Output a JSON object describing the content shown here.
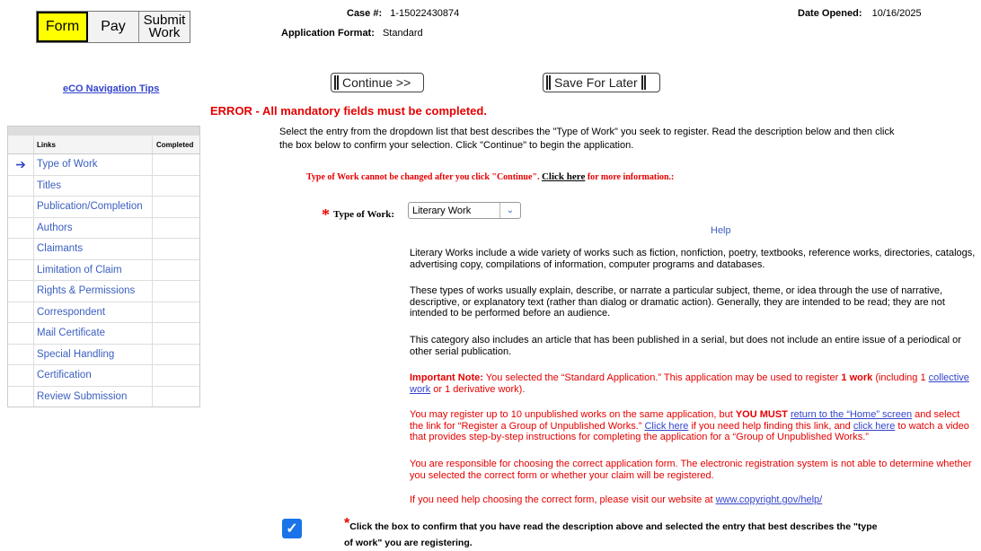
{
  "tabs": {
    "form": "Form",
    "pay": "Pay",
    "submit": "Submit Work"
  },
  "case": {
    "label": "Case #:",
    "value": "1-15022430874"
  },
  "format": {
    "label": "Application Format:",
    "value": "Standard"
  },
  "date_opened": {
    "label": "Date Opened:",
    "value": "10/16/2025"
  },
  "nav_tips": "eCO Navigation Tips",
  "buttons": {
    "continue": "Continue >>",
    "save": "Save For Later"
  },
  "error": "ERROR - All mandatory fields must be completed.",
  "instructions": "Select the entry from the dropdown list that best describes the \"Type of Work\" you seek to register. Read the description below and then click the box below to confirm your selection. Click \"Continue\" to begin the application.",
  "warning": {
    "text": "Type of Work cannot be changed after you click \"Continue\".",
    "link": "Click here",
    "after": "for more information.:"
  },
  "sidebar": {
    "header_links": "Links",
    "header_completed": "Completed",
    "items": [
      {
        "label": "Type of Work",
        "current": true
      },
      {
        "label": "Titles"
      },
      {
        "label": "Publication/Completion"
      },
      {
        "label": "Authors"
      },
      {
        "label": "Claimants"
      },
      {
        "label": "Limitation of Claim"
      },
      {
        "label": "Rights & Permissions"
      },
      {
        "label": "Correspondent"
      },
      {
        "label": "Mail Certificate"
      },
      {
        "label": "Special Handling"
      },
      {
        "label": "Certification"
      },
      {
        "label": "Review Submission"
      }
    ]
  },
  "type_of_work": {
    "label": "Type of Work:",
    "selected": "Literary Work",
    "help": "Help"
  },
  "description": {
    "p1": "Literary Works include a wide variety of works such as fiction, nonfiction, poetry, textbooks, reference works, directories, catalogs, advertising copy, compilations of information, computer programs and databases.",
    "p2": "These types of works usually explain, describe, or narrate a particular subject, theme, or idea through the use of narrative, descriptive, or explanatory text (rather than dialog or dramatic action). Generally, they are intended to be read; they are not intended to be performed before an audience.",
    "p3": "This category also includes an article that has been published in a serial, but does not include an entire issue of a periodical or other serial publication.",
    "important_label": "Important Note:",
    "important_a": "You selected the “Standard Application.” This application may be used to register",
    "important_b": "1 work",
    "important_c": "(including 1",
    "important_link": "collective work",
    "important_d": "or 1 derivative work).",
    "p5_a": "You may register up to 10 unpublished works on the same application, but",
    "p5_must": "YOU MUST",
    "p5_link1": "return to the “Home” screen",
    "p5_b": "and select the link for “Register a Group of Unpublished Works.”",
    "p5_link2": "Click here",
    "p5_c": "if you need help finding this link, and",
    "p5_link3": "click here",
    "p5_d": "to watch a video that provides step-by-step instructions for completing the application for a “Group of Unpublished Works.”",
    "p6": "You are responsible for choosing the correct application form. The electronic registration system is not able to determine whether you selected the correct form or whether your claim will be registered.",
    "p7_a": "If you need help choosing the correct form, please visit our website at",
    "p7_link": "www.copyright.gov/help/"
  },
  "confirm": "Click the box to confirm that you have read the description above and selected the entry that best describes the \"type of work\" you are registering.",
  "colors": {
    "error_red": "#e60000",
    "link_blue": "#3344cc",
    "form_tab_yellow": "#ffff00",
    "checkbox_blue": "#1a73e8"
  }
}
